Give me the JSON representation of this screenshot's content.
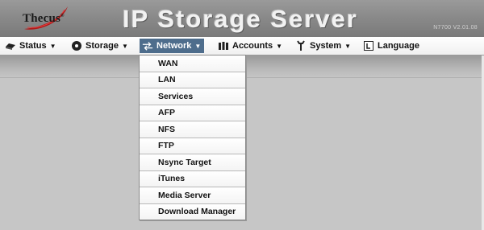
{
  "header": {
    "logo_text": "Thecus",
    "logo_mark": "®",
    "title": "IP Storage Server",
    "version": "N7700 V2.01.08"
  },
  "menu": {
    "items": [
      {
        "label": "Status",
        "icon": "status-icon"
      },
      {
        "label": "Storage",
        "icon": "storage-disk-icon"
      },
      {
        "label": "Network",
        "icon": "network-icon",
        "active": true
      },
      {
        "label": "Accounts",
        "icon": "accounts-icon"
      },
      {
        "label": "System",
        "icon": "system-wrench-icon"
      },
      {
        "label": "Language",
        "icon": "language-icon"
      }
    ]
  },
  "network_menu": {
    "items": [
      "WAN",
      "LAN",
      "Services",
      "AFP",
      "NFS",
      "FTP",
      "Nsync Target",
      "iTunes",
      "Media Server",
      "Download Manager"
    ]
  },
  "colors": {
    "header_bg": "#8a8a8a",
    "active_menu_bg": "#4e6d8c",
    "logo_swoosh": "#b01818",
    "page_bg": "#c6c6c6"
  }
}
